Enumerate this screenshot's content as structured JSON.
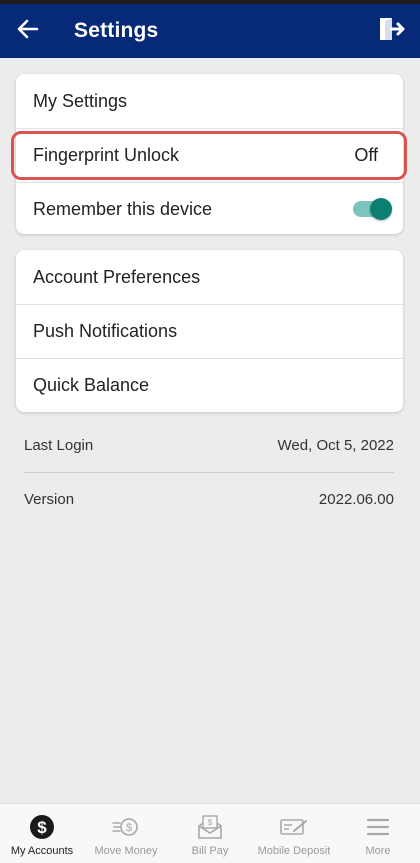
{
  "colors": {
    "appbar": "#062a78",
    "highlight": "#d9534f",
    "toggle_on": "#0d7f71"
  },
  "appbar": {
    "title": "Settings",
    "back_icon": "arrow-left-icon",
    "logout_icon": "logout-icon"
  },
  "card1": {
    "header": "My Settings",
    "fingerprint_label": "Fingerprint Unlock",
    "fingerprint_value": "Off",
    "remember_label": "Remember this device",
    "remember_on": true
  },
  "card2": {
    "items": [
      "Account Preferences",
      "Push Notifications",
      "Quick Balance"
    ]
  },
  "info": {
    "last_login_label": "Last Login",
    "last_login_value": "Wed, Oct 5, 2022",
    "version_label": "Version",
    "version_value": "2022.06.00"
  },
  "bottom_nav": {
    "items": [
      {
        "label": "My Accounts",
        "icon": "dollar-circle-icon",
        "active": true
      },
      {
        "label": "Move Money",
        "icon": "move-money-icon",
        "active": false
      },
      {
        "label": "Bill Pay",
        "icon": "bill-pay-icon",
        "active": false
      },
      {
        "label": "Mobile Deposit",
        "icon": "check-deposit-icon",
        "active": false
      },
      {
        "label": "More",
        "icon": "menu-icon",
        "active": false
      }
    ]
  }
}
